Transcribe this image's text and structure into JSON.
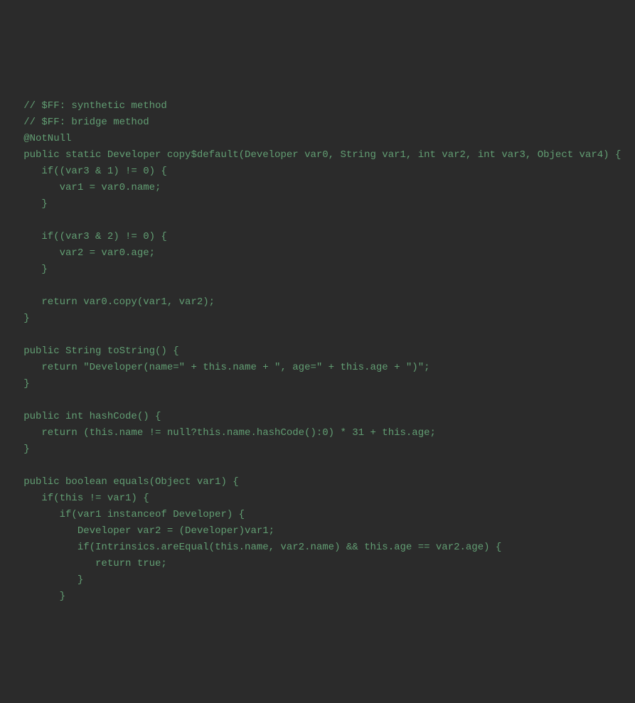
{
  "code_lines": [
    "   // $FF: synthetic method",
    "   // $FF: bridge method",
    "   @NotNull",
    "   public static Developer copy$default(Developer var0, String var1, int var2, int var3, Object var4) {",
    "      if((var3 & 1) != 0) {",
    "         var1 = var0.name;",
    "      }",
    "",
    "      if((var3 & 2) != 0) {",
    "         var2 = var0.age;",
    "      }",
    "",
    "      return var0.copy(var1, var2);",
    "   }",
    "",
    "   public String toString() {",
    "      return \"Developer(name=\" + this.name + \", age=\" + this.age + \")\";",
    "   }",
    "",
    "   public int hashCode() {",
    "      return (this.name != null?this.name.hashCode():0) * 31 + this.age;",
    "   }",
    "",
    "   public boolean equals(Object var1) {",
    "      if(this != var1) {",
    "         if(var1 instanceof Developer) {",
    "            Developer var2 = (Developer)var1;",
    "            if(Intrinsics.areEqual(this.name, var2.name) && this.age == var2.age) {",
    "               return true;",
    "            }",
    "         }"
  ]
}
